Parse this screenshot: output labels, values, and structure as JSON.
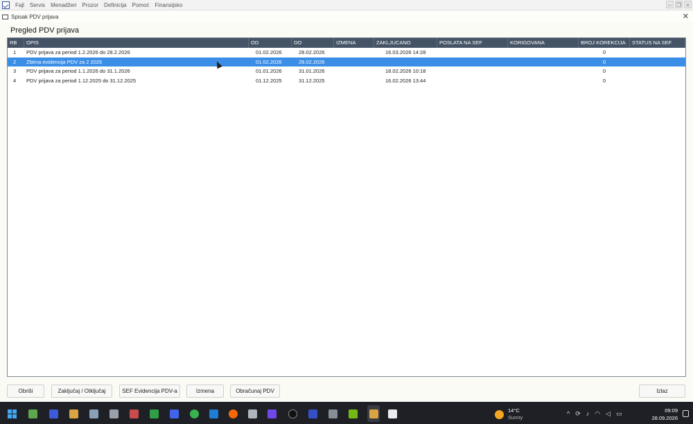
{
  "menubar": {
    "items": [
      "Fajl",
      "Servis",
      "Menadžeri",
      "Prozor",
      "Definicija",
      "Pomoć",
      "Finansijsko"
    ]
  },
  "document": {
    "title": "Spisak PDV prijava"
  },
  "section_title": "Pregled PDV prijava",
  "table": {
    "columns": [
      "RB",
      "OPIS",
      "OD",
      "DO",
      "IZMENA",
      "ZAKLJUCANO",
      "POSLATA NA SEF",
      "KORIGOVANA",
      "BROJ KOREKCIJA",
      "STATUS NA SEF"
    ],
    "rows": [
      {
        "rb": "1",
        "opis": "PDV prijava za period 1.2.2026 do 28.2.2026",
        "od": "01.02.2026",
        "do": "28.02.2026",
        "izmena": "",
        "zakljucano": "16.03.2026 14:28",
        "poslata": "",
        "korigovana": "",
        "broj": "0",
        "status": ""
      },
      {
        "rb": "2",
        "opis": "Zbirna evidencija PDV za 2 2026",
        "od": "01.02.2026",
        "do": "28.02.2026",
        "izmena": "",
        "zakljucano": "",
        "poslata": "",
        "korigovana": "",
        "broj": "0",
        "status": ""
      },
      {
        "rb": "3",
        "opis": "PDV prijava za period 1.1.2026 do 31.1.2026",
        "od": "01.01.2026",
        "do": "31.01.2026",
        "izmena": "",
        "zakljucano": "18.02.2026 10:18",
        "poslata": "",
        "korigovana": "",
        "broj": "0",
        "status": ""
      },
      {
        "rb": "4",
        "opis": "PDV prijava za period 1.12.2025 do 31.12.2025",
        "od": "01.12.2025",
        "do": "31.12.2025",
        "izmena": "",
        "zakljucano": "16.02.2026 13:44",
        "poslata": "",
        "korigovana": "",
        "broj": "0",
        "status": ""
      }
    ],
    "selected_row": 1
  },
  "buttons": {
    "obrisi": "Obriši",
    "zakljucaj": "Zaključaj / Otključaj",
    "sef": "SEF Evidencija PDV-a",
    "izmena": "Izmena",
    "obracunaj": "Obračunaj PDV",
    "izlaz": "Izlaz"
  },
  "taskbar": {
    "weather_temp": "14°C",
    "weather_desc": "Sunny",
    "time": "09:09",
    "date": "28.09.2026"
  },
  "colors": {
    "header_bg": "#445365",
    "selected_row": "#3a8ee6",
    "taskbar_bg": "#1f2026"
  }
}
